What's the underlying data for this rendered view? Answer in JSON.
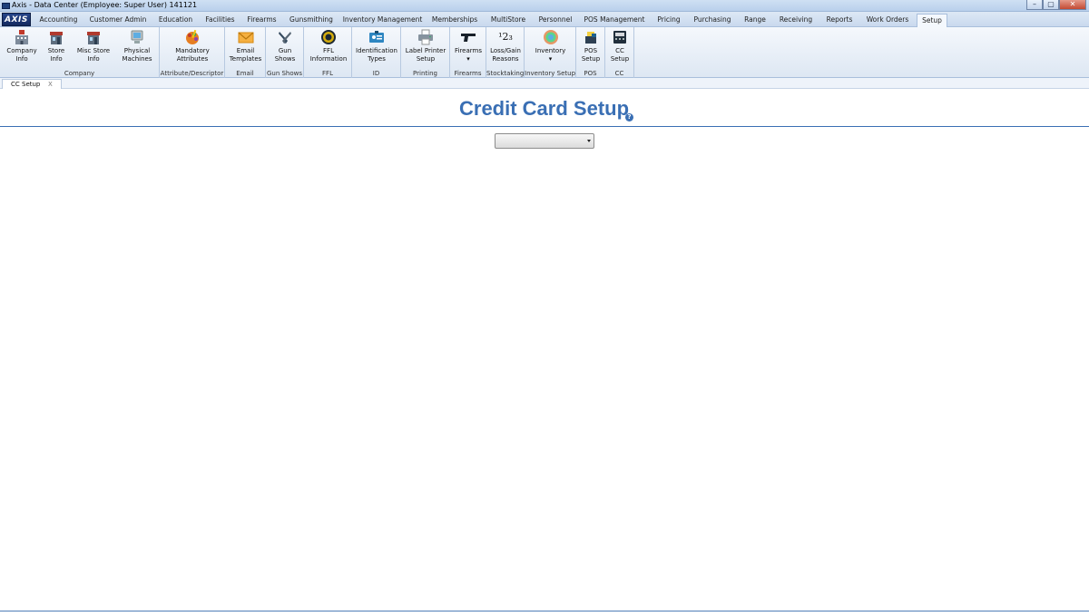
{
  "window": {
    "title": "Axis - Data Center  (Employee: Super User) 141121",
    "minimize_glyph": "–",
    "maximize_glyph": "▢",
    "close_glyph": "✕"
  },
  "menubar": {
    "logo": "AXIS",
    "tabs": [
      "Accounting",
      "Customer Admin",
      "Education",
      "Facilities",
      "Firearms",
      "Gunsmithing",
      "Inventory Management",
      "Memberships",
      "MultiStore",
      "Personnel",
      "POS Management",
      "Pricing",
      "Purchasing",
      "Range",
      "Receiving",
      "Reports",
      "Work Orders",
      "Setup"
    ],
    "active_tab": "Setup"
  },
  "ribbon": {
    "groups": [
      {
        "label": "Company",
        "buttons": [
          {
            "line1": "Company",
            "line2": "Info",
            "icon": "building-icon"
          },
          {
            "line1": "Store",
            "line2": "Info",
            "icon": "storefront-icon"
          },
          {
            "line1": "Misc Store",
            "line2": "Info",
            "icon": "storefront-icon"
          },
          {
            "line1": "Physical",
            "line2": "Machines",
            "icon": "computer-icon"
          }
        ]
      },
      {
        "label": "Attribute/Descriptor",
        "buttons": [
          {
            "line1": "Mandatory",
            "line2": "Attributes",
            "icon": "paint-palette-icon"
          }
        ]
      },
      {
        "label": "Email",
        "buttons": [
          {
            "line1": "Email",
            "line2": "Templates",
            "icon": "envelope-icon"
          }
        ]
      },
      {
        "label": "Gun Shows",
        "buttons": [
          {
            "line1": "Gun",
            "line2": "Shows",
            "icon": "crossed-pistols-icon"
          }
        ]
      },
      {
        "label": "FFL",
        "buttons": [
          {
            "line1": "FFL",
            "line2": "Information",
            "icon": "seal-icon"
          }
        ]
      },
      {
        "label": "ID",
        "buttons": [
          {
            "line1": "Identification",
            "line2": "Types",
            "icon": "id-card-icon"
          }
        ]
      },
      {
        "label": "Printing",
        "buttons": [
          {
            "line1": "Label Printer",
            "line2": "Setup",
            "icon": "printer-icon"
          }
        ]
      },
      {
        "label": "Firearms",
        "buttons": [
          {
            "line1": "Firearms",
            "line2": "▾",
            "icon": "pistol-icon"
          }
        ]
      },
      {
        "label": "Stocktaking",
        "buttons": [
          {
            "line1": "Loss/Gain",
            "line2": "Reasons",
            "icon": "numbers-icon",
            "glyph": "¹2₃"
          }
        ]
      },
      {
        "label": "Inventory Setup",
        "buttons": [
          {
            "line1": "Inventory",
            "line2": "▾",
            "icon": "globe-icon"
          }
        ]
      },
      {
        "label": "POS",
        "buttons": [
          {
            "line1": "POS",
            "line2": "Setup",
            "icon": "register-icon"
          }
        ]
      },
      {
        "label": "CC",
        "buttons": [
          {
            "line1": "CC",
            "line2": "Setup",
            "icon": "card-terminal-icon"
          }
        ]
      }
    ]
  },
  "doctabs": [
    {
      "label": "CC Setup",
      "close": "X"
    }
  ],
  "page": {
    "title": "Credit Card Setup",
    "help_glyph": "?",
    "select_value": ""
  },
  "colors": {
    "accent": "#3a6fb4",
    "menubar": "#c9d9ee",
    "ribbon": "#dde7f3"
  }
}
